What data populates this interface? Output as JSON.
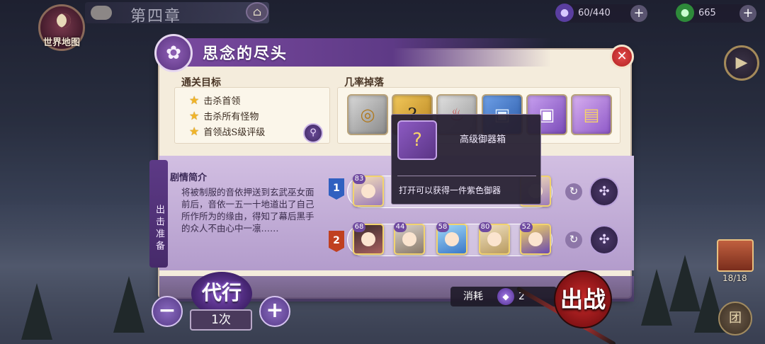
{
  "top_bar": {
    "world_map_label": "世界地图",
    "chapter_title": "第四章",
    "stamina": "60/440",
    "currency": "665",
    "add_symbol": "+"
  },
  "dialog": {
    "title": "思念的尽头",
    "close_symbol": "✕",
    "objectives_label": "通关目标",
    "objectives": [
      "击杀首领",
      "击杀所有怪物",
      "首领战S级评级"
    ],
    "drops_label": "几率掉落",
    "tooltip": {
      "name": "高级御器箱",
      "description": "打开可以获得一件紫色御器"
    },
    "side_tab": "出击准备",
    "story_label": "剧情简介",
    "story_text": "将被制服的音依押送到玄武巫女面前后，音依一五一十地道出了自己所作所为的缘由，得知了幕后黑手的众人不由心中一凛……",
    "teams": [
      {
        "number": "1",
        "heroes": [
          {
            "level": "83"
          },
          {
            "level": ""
          },
          {
            "level": ""
          },
          {
            "level": ""
          },
          {
            "level": ""
          }
        ]
      },
      {
        "number": "2",
        "heroes": [
          {
            "level": "68"
          },
          {
            "level": "44"
          },
          {
            "level": "58"
          },
          {
            "level": "80"
          },
          {
            "level": "52"
          }
        ]
      }
    ]
  },
  "bottom": {
    "auto_label": "代行",
    "minus": "−",
    "plus": "+",
    "times": "1次",
    "cost_label": "消耗",
    "cost_value": "2",
    "battle_label": "出战",
    "chest_count": "18/18",
    "group_label": "团"
  },
  "colors": {
    "accent_purple": "#5e3a86",
    "panel_bg": "#f4ecdc",
    "battle_red": "#c92a2a",
    "star_gold": "#f0b428"
  }
}
